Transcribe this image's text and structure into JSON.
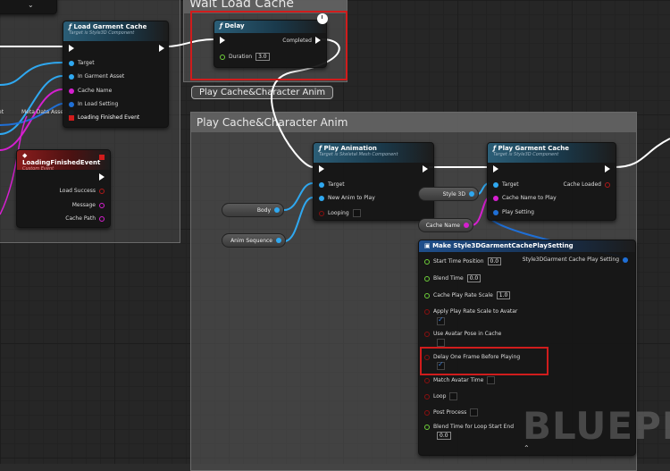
{
  "comments": {
    "wait_load_cache": "Wait Load Cache",
    "play_cache_anim": "Play Cache&Character Anim",
    "play_cache_anim_tag": "Play Cache&Character Anim"
  },
  "load_garment_cache": {
    "title": "Load Garment Cache",
    "subtitle": "Target is Style3D Component",
    "pins": [
      "Target",
      "In Garment Asset",
      "Cache Name",
      "In Load Setting",
      "Loading Finished Event"
    ]
  },
  "left_partial": {
    "meta_data_asset": "Meta Data Asset",
    "et": "et"
  },
  "loading_finished_event": {
    "title": "LoadingFinishedEvent",
    "subtitle": "Custom Event",
    "pins": [
      "Load Success",
      "Message",
      "Cache Path"
    ]
  },
  "delay": {
    "title": "Delay",
    "completed": "Completed",
    "duration_label": "Duration",
    "duration_value": "3.0"
  },
  "play_animation": {
    "title": "Play Animation",
    "subtitle": "Target is Skeletal Mesh Component",
    "pins": [
      "Target",
      "New Anim to Play",
      "Looping"
    ]
  },
  "play_garment_cache": {
    "title": "Play Garment Cache",
    "subtitle": "Target is Style3D Component",
    "target": "Target",
    "cache_loaded": "Cache Loaded",
    "cache_name_to_play": "Cache Name to Play",
    "play_setting": "Play Setting"
  },
  "vars": {
    "body": "Body",
    "anim_sequence": "Anim Sequence",
    "style3d": "Style 3D",
    "cache_name": "Cache Name"
  },
  "make_setting": {
    "title": "Make Style3DGarmentCachePlaySetting",
    "output": "Style3DGarment Cache Play Setting",
    "start_time_label": "Start Time Position",
    "start_time_value": "0.0",
    "blend_time_label": "Blend Time",
    "blend_time_value": "0.0",
    "play_rate_label": "Cache Play Rate Scale",
    "play_rate_value": "1.0",
    "apply_rate_label": "Apply Play Rate Scale to Avatar",
    "use_pose_label": "Use Avatar Pose in Cache",
    "delay_frame_label": "Delay One Frame Before Playing",
    "match_time_label": "Match Avatar Time",
    "loop_label": "Loop",
    "post_process_label": "Post Process",
    "blend_loop_label": "Blend Time for Loop Start End",
    "blend_loop_value": "0.0"
  },
  "watermark": "BLUEPR",
  "colors": {
    "highlight": "#d01c1c",
    "object_pin": "#2fa8f0",
    "name_pin": "#d61fd0",
    "struct_pin": "#1f6fd6",
    "bool_pin": "#8a0f0f",
    "float_pin": "#6fd03a"
  }
}
